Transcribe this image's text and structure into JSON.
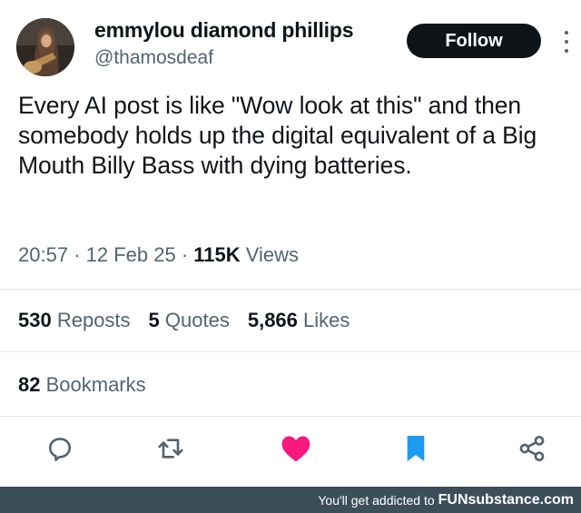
{
  "author": {
    "display_name": "emmylou diamond phillips",
    "handle": "@thamosdeaf"
  },
  "follow_label": "Follow",
  "tweet_text": "Every AI post is like \"Wow look at this\" and then somebody holds up the digital equivalent of a Big Mouth Billy Bass with dying batteries.",
  "meta": {
    "time": "20:57",
    "sep1": " · ",
    "date": "12 Feb 25",
    "sep2": " · ",
    "views_count": "115K",
    "views_label": " Views"
  },
  "stats": {
    "reposts_count": "530",
    "reposts_label": " Reposts",
    "quotes_count": "5",
    "quotes_label": " Quotes",
    "likes_count": "5,866",
    "likes_label": " Likes"
  },
  "bookmarks": {
    "count": "82",
    "label": " Bookmarks"
  },
  "actions": {
    "reply_icon": "reply-icon",
    "retweet_icon": "retweet-icon",
    "like_icon": "heart-icon",
    "bookmark_icon": "bookmark-icon",
    "share_icon": "share-icon"
  },
  "colors": {
    "text": "#0f1419",
    "secondary": "#536471",
    "like": "#f91880",
    "bookmark": "#1d9bf0",
    "footer_bg": "#3d4e5b"
  },
  "footer": {
    "text": "You'll get addicted to",
    "brand": "FUNsubstance.com"
  }
}
